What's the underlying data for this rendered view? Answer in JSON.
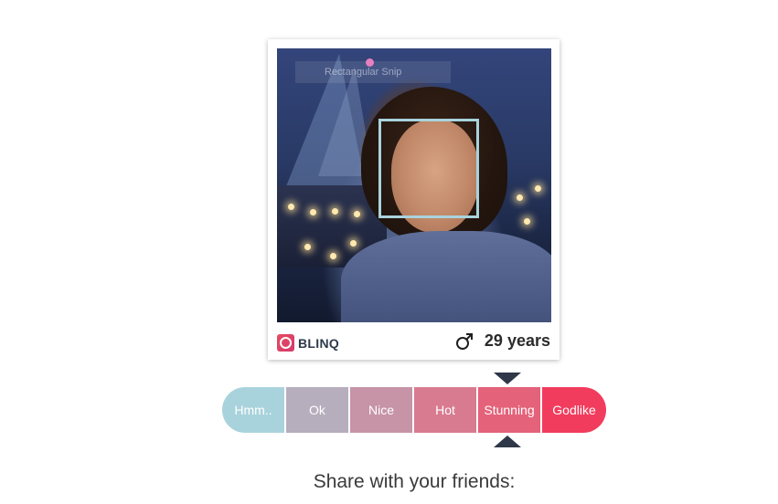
{
  "card": {
    "snip_label": "Rectangular Snip",
    "brand": "BLINQ",
    "gender_icon": "male-icon",
    "age": "29 years"
  },
  "rating_scale": {
    "selected": "Stunning",
    "items": [
      {
        "label": "Hmm..",
        "color": "#a9d3dc"
      },
      {
        "label": "Ok",
        "color": "#b7aebd"
      },
      {
        "label": "Nice",
        "color": "#c694a6"
      },
      {
        "label": "Hot",
        "color": "#d87b91"
      },
      {
        "label": "Stunning",
        "color": "#e4627a"
      },
      {
        "label": "Godlike",
        "color": "#f23c5d"
      }
    ]
  },
  "share": {
    "text": "Share with your friends:"
  }
}
